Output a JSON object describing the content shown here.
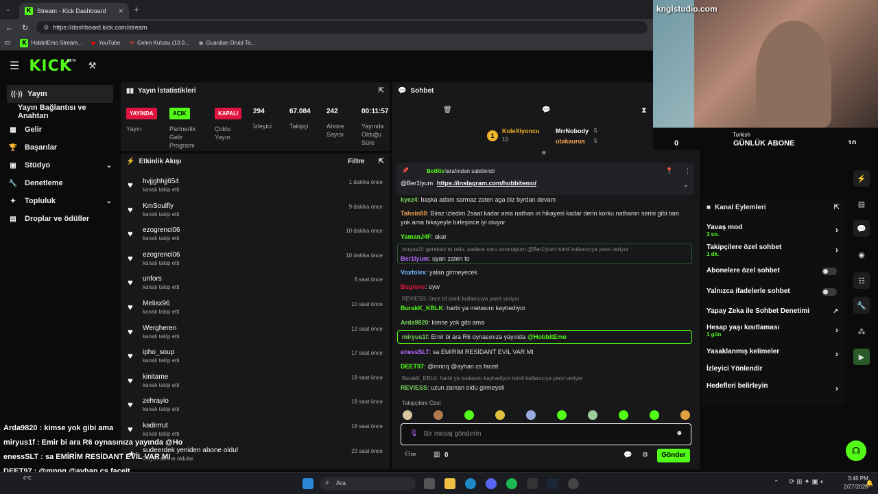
{
  "browser": {
    "tab_title": "Stream - Kick Dashboard",
    "url": "https://dashboard.kick.com/stream",
    "bookmarks": [
      "HobbitEmo Stream...",
      "YouTube",
      "Gelen Kutusu (13.0...",
      "Guardian Druid Ta..."
    ]
  },
  "header": {
    "logo": "KICK",
    "beta": "BETA"
  },
  "sidebar": {
    "items": [
      {
        "label": "Yayın",
        "icon": "broadcast-icon"
      },
      {
        "label": "Yayın Bağlantısı ve Anahtarı",
        "icon": ""
      },
      {
        "label": "Gelir",
        "icon": "revenue-icon"
      },
      {
        "label": "Başarılar",
        "icon": "trophy-icon"
      },
      {
        "label": "Stüdyo",
        "icon": "studio-icon"
      },
      {
        "label": "Denetleme",
        "icon": "wrench-icon"
      },
      {
        "label": "Topluluk",
        "icon": "community-icon"
      },
      {
        "label": "Droplar ve ödüller",
        "icon": "gift-icon"
      }
    ]
  },
  "stats": {
    "title": "Yayın İstatistikleri",
    "badges": [
      {
        "badge": "YAYINDA",
        "label": "Yayın",
        "color": "#e0153f"
      },
      {
        "badge": "AÇIK",
        "label": "Partnerlik Gelir Programı",
        "color": "#53fc18"
      },
      {
        "badge": "KAPALI",
        "label": "Çoklu Yayın",
        "color": "#e0153f"
      }
    ],
    "viewers": {
      "value": "294",
      "label": "İzleyici"
    },
    "followers": {
      "value": "67.084",
      "label": "Takipçi"
    },
    "subs": {
      "value": "242",
      "label": "Abone Sayısı"
    },
    "duration": {
      "value": "00:11:57",
      "label": "Yayında Olduğu Süre"
    }
  },
  "feed": {
    "title": "Etkinlik Akışı",
    "filter": "Filtre",
    "items": [
      {
        "name": "hvjjghhjj654",
        "sub": "kanalı takip etti",
        "time": "1 dakika önce"
      },
      {
        "name": "KmSoulfly",
        "sub": "kanalı takip etti",
        "time": "9 dakika önce"
      },
      {
        "name": "ezogrenci06",
        "sub": "kanalı takip etti",
        "time": "10 dakika önce"
      },
      {
        "name": "ezogrenci06",
        "sub": "kanalı takip etti",
        "time": "10 dakika önce"
      },
      {
        "name": "unfors",
        "sub": "kanalı takip etti",
        "time": "8 saat önce"
      },
      {
        "name": "Melisx96",
        "sub": "kanalı takip etti",
        "time": "10 saat önce"
      },
      {
        "name": "Wergheren",
        "sub": "kanalı takip etti",
        "time": "12 saat önce"
      },
      {
        "name": "ipho_soup",
        "sub": "kanalı takip etti",
        "time": "17 saat önce"
      },
      {
        "name": "kinitame",
        "sub": "kanalı takip etti",
        "time": "18 saat önce"
      },
      {
        "name": "zehrayio",
        "sub": "kanalı takip etti",
        "time": "18 saat önce"
      },
      {
        "name": "kadirrrut",
        "sub": "kanalı takip etti",
        "time": "18 saat önce"
      },
      {
        "name": "sudeerdek yeniden abone oldu!",
        "sub": "3 aylık abone oldular",
        "time": "23 saat önce"
      }
    ]
  },
  "chat": {
    "title": "Sohbet",
    "top_users": [
      {
        "name": "KoleXiyoncu",
        "count": "10"
      },
      {
        "name": "MrrNobody",
        "count": "5"
      },
      {
        "name": "utakaurus",
        "count": "5"
      }
    ],
    "pinned_by": "BotRix",
    "pinned_suffix": "tarafından sabitlendi",
    "pinned_user": "@Ber1lyum",
    "pinned_link": "https://instagram.com/hobbitemo/",
    "messages": [
      {
        "user": "kyez4",
        "text": "başka adam sarmaz zaten aga biz byrdan devam",
        "color": "#7ad35a"
      },
      {
        "user": "Tahsin50",
        "text": "Biraz izledim 2saat kadar ama nathan ın hikayesi kadar derin korku nathanın serisi gibi tam yok ama hikayeyle birleşince iyi oluyor",
        "color": "#f0a050"
      },
      {
        "user": "YamanJ4F",
        "text": "akar",
        "color": "#53fc18"
      },
      {
        "user": "Ber1lyum",
        "text": "uyarı zaten to",
        "color": "#b36bff",
        "reply": "miryus1f: gereksiz to oldu. sadece soru sormuştum @Ber1lyum isimli kullanıcıya yanıt veriyor"
      },
      {
        "user": "Voxfolex",
        "text": "yalan girmeyecek",
        "color": "#6fb6ff"
      },
      {
        "user": "Bugione",
        "text": "eyw",
        "color": "#e0153f"
      },
      {
        "user": "BurakK_KBLK",
        "text": "harbi ya metasını kaybediyor",
        "color": "#53fc18",
        "reply": "REVIESS: önce bf isimli kullanıcıya yanıt veriyor"
      },
      {
        "user": "Arda9820",
        "text": "kimse yok gibi ama",
        "color": "#7ad35a"
      },
      {
        "user": "miryus1f",
        "text": "Emir bi ara R6 oynasınıza yayında",
        "mention": "@HobbitEmo",
        "color": "#7ad35a"
      },
      {
        "user": "enessSLT",
        "text": "sa EMİRİM RESİDANT EVİL VAR MI",
        "color": "#b36bff"
      },
      {
        "user": "DEET97",
        "text": "@mnnq @ayhan cs faceit",
        "color": "#53fc18"
      },
      {
        "user": "REVIESS",
        "text": "uzun zaman oldu girmeyeli",
        "color": "#7ad35a",
        "reply": "BurakK_KBLK: harbi ya metasını kaybediyor isimli kullanıcıya yanıt veriyor"
      }
    ],
    "followers_only": "Takipçilere Özel",
    "input_placeholder": "Bir mesaj gönderin",
    "send": "Gönder",
    "points": "0"
  },
  "stream_overlay": {
    "brand": "knglstudio.com",
    "language": "Turkish",
    "goal_label": "GÜNLÜK ABONE",
    "goal_current": "0",
    "goal_target": "10",
    "goal_progress": 0,
    "chat_overlay": [
      {
        "user": "Arda9820",
        "text": "kimse yok gibi ama"
      },
      {
        "user": "miryus1f",
        "text": "Emir bi ara R6 oynasınıza yayında @Ho"
      },
      {
        "user": "enessSLT",
        "text": "sa EMİRİM RESİDANT EVİL VAR MI"
      },
      {
        "user": "DEET97",
        "text": "@mnnq @ayhan cs faceit"
      },
      {
        "user": "REVIESS",
        "text": "uzun zaman oldu girmeyeli"
      }
    ]
  },
  "channel_actions": {
    "title": "Kanal Eylemleri",
    "items": [
      {
        "label": "Yavaş mod",
        "sub": "3 sn.",
        "type": "arrow"
      },
      {
        "label": "Takipçilere özel sohbet",
        "sub": "1 dk.",
        "type": "arrow"
      },
      {
        "label": "Abonelere özel sohbet",
        "sub": "",
        "type": "toggle"
      },
      {
        "label": "Yalnızca ifadelerle sohbet",
        "sub": "",
        "type": "toggle"
      },
      {
        "label": "Yapay Zeka ile Sohbet Denetimi",
        "sub": "",
        "type": "external"
      },
      {
        "label": "Hesap yaşı kısıtlaması",
        "sub": "1 gün",
        "type": "arrow"
      },
      {
        "label": "Yasaklanmış kelimeler",
        "sub": "",
        "type": "arrow"
      },
      {
        "label": "İzleyici Yönlendir",
        "sub": "",
        "type": "none"
      },
      {
        "label": "Hedefleri belirleyin",
        "sub": "",
        "type": "arrow"
      }
    ]
  },
  "taskbar": {
    "search": "Ara",
    "time": "3:46 PM",
    "date": "2/27/2026",
    "temp": "6°C"
  },
  "colors": {
    "accent": "#53fc18",
    "live": "#e0153f",
    "panel": "#18181a"
  }
}
